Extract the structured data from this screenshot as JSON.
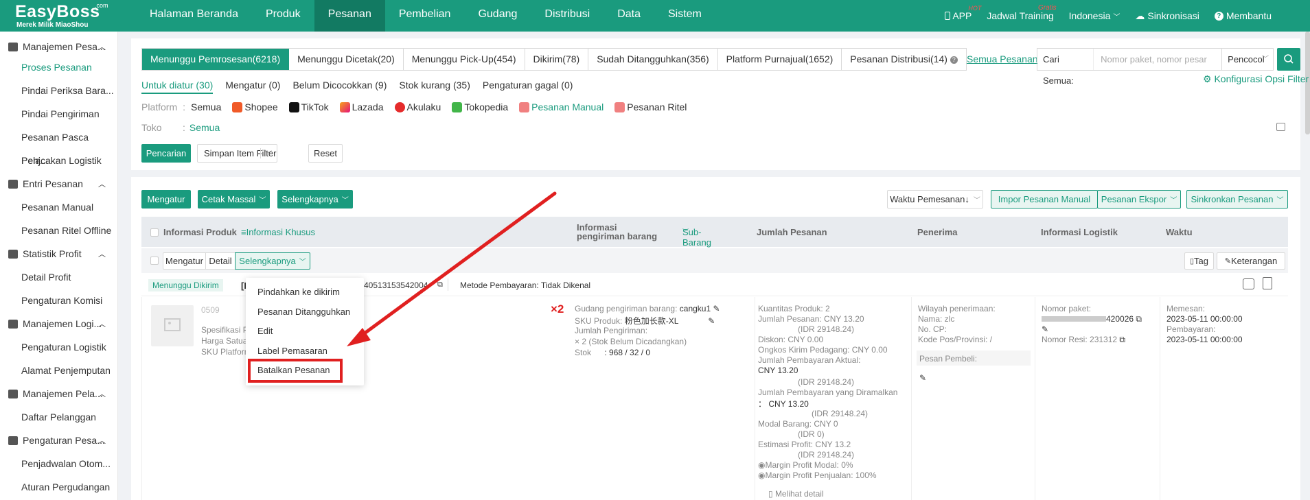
{
  "brand": {
    "name": "EasyBoss",
    "com": ".com",
    "sub": "Merek Milik MiaoShou"
  },
  "nav": [
    "Halaman Beranda",
    "Produk",
    "Pesanan",
    "Pembelian",
    "Gudang",
    "Distribusi",
    "Data",
    "Sistem"
  ],
  "top_right": {
    "app": "APP",
    "hot": "HOT",
    "training": "Jadwal Training",
    "gratis": "Gratis",
    "lang": "Indonesia",
    "sync": "Sinkronisasi",
    "help": "Membantu"
  },
  "sidebar": {
    "groups": [
      "Manajemen Pesa...",
      "Entri Pesanan",
      "Statistik Profit",
      "Manajemen Logi...",
      "Manajemen Pela...",
      "Pengaturan Pesa..."
    ],
    "items": [
      "Proses Pesanan",
      "Pindai Periksa Bara...",
      "Pindai Pengiriman",
      "Pesanan Pasca Penj...",
      "Pelacakan Logistik",
      "Pesanan Manual",
      "Pesanan Ritel Offline",
      "Detail Profit",
      "Pengaturan Komisi",
      "Pengaturan Logistik",
      "Alamat Penjemputan",
      "Daftar Pelanggan",
      "Penjadwalan Otom...",
      "Aturan Pergudangan"
    ]
  },
  "status_tabs": [
    "Menunggu Pemrosesan(6218)",
    "Menunggu Dicetak(20)",
    "Menunggu Pick-Up(454)",
    "Dikirim(78)",
    "Sudah Ditangguhkan(356)",
    "Platform Purnajual(1652)",
    "Pesanan Distribusi(14)"
  ],
  "semua_pesanan": "Semua Pesanan",
  "search": {
    "label": "Cari Semua:",
    "placeholder": "Nomor paket, nomor pesar",
    "select": "Pencocol"
  },
  "sub_tabs": [
    "Untuk diatur (30)",
    "Mengatur (0)",
    "Belum Dicocokkan (9)",
    "Stok kurang (35)",
    "Pengaturan gagal (0)"
  ],
  "konfig": "Konfigurasi Opsi Filter",
  "platform": {
    "label": "Platform",
    "items": [
      "Semua",
      "Shopee",
      "TikTok",
      "Lazada",
      "Akulaku",
      "Tokopedia",
      "Pesanan Manual",
      "Pesanan Ritel"
    ]
  },
  "toko": {
    "label": "Toko",
    "value": "Semua"
  },
  "filter_buttons": {
    "search": "Pencarian",
    "save": "Simpan Item Filter",
    "reset": "Reset"
  },
  "action_buttons": {
    "mengatur": "Mengatur",
    "cetak": "Cetak Massal",
    "selengkapnya": "Selengkapnya",
    "waktu": "Waktu Pemesanan↓",
    "impor": "Impor Pesanan Manual",
    "ekspor": "Pesanan Ekspor",
    "sinkron": "Sinkronkan Pesanan"
  },
  "table_head": {
    "produk": "Informasi Produk",
    "khusus": "≡Informasi Khusus",
    "pengiriman": "Informasi pengiriman barang",
    "sub": "Sub-Barang",
    "jumlah": "Jumlah Pesanan",
    "penerima": "Penerima",
    "logistik": "Informasi Logistik",
    "waktu": "Waktu"
  },
  "row_buttons": {
    "mengatur": "Mengatur",
    "detail": "Detail",
    "selengkapnya": "Selengkapnya",
    "tag": "Tag",
    "keterangan": "Keterangan"
  },
  "order": {
    "status": "Menunggu Dikirim",
    "id_prefix": "[F",
    "order_no": "40513153542004",
    "payment": "Metode Pembayaran: Tidak Dikenal",
    "product_title": "0509",
    "product_lines": [
      "Spesifikasi Pro",
      "Harga Satuan",
      "SKU Platform"
    ],
    "qty_mark": "×2",
    "gudang_label": "Gudang pengiriman barang:",
    "gudang": "cangku1",
    "sku_label": "SKU Produk:",
    "sku": "粉色加长款-XL",
    "jumlah_kirim": "Jumlah Pengiriman:",
    "kirim_val": "× 2 (Stok Belum Dicadangkan)",
    "stok_label": "Stok",
    "stok": ": 968 / 32 / 0",
    "amounts": [
      "Kuantitas Produk: 2",
      "Jumlah Pesanan: CNY 13.20",
      "(IDR 29148.24)",
      "Diskon: CNY 0.00",
      "Ongkos Kirim Pedagang: CNY 0.00",
      "Jumlah Pembayaran Aktual:",
      "CNY 13.20",
      "(IDR 29148.24)",
      "Jumlah Pembayaran yang Diramalkan",
      "： CNY 13.20",
      "(IDR 29148.24)",
      "Modal Barang: CNY 0",
      "(IDR 0)",
      "Estimasi Profit: CNY 13.2",
      "(IDR 29148.24)",
      "Margin Profit Modal: 0%",
      "Margin Profit Penjualan: 100%",
      "Melihat detail"
    ],
    "penerima": [
      "Wilayah penerimaan:",
      "Nama: zlc",
      "No. CP:",
      "Kode Pos/Provinsi: /",
      "Pesan Pembeli:"
    ],
    "logistik": {
      "paket_label": "Nomor paket:",
      "paket": "420026",
      "resi": "Nomor Resi: 231312"
    },
    "waktu": {
      "pesan_label": "Memesan:",
      "pesan": "2023-05-11 00:00:00",
      "bayar_label": "Pembayaran:",
      "bayar": "2023-05-11 00:00:00"
    }
  },
  "dropdown": [
    "Pindahkan ke dikirim",
    "Pesanan Ditangguhkan",
    "Edit",
    "Label Pemasaran",
    "Batalkan Pesanan"
  ],
  "colors": {
    "brand": "#1a9b7e",
    "annotation": "#e02020"
  }
}
